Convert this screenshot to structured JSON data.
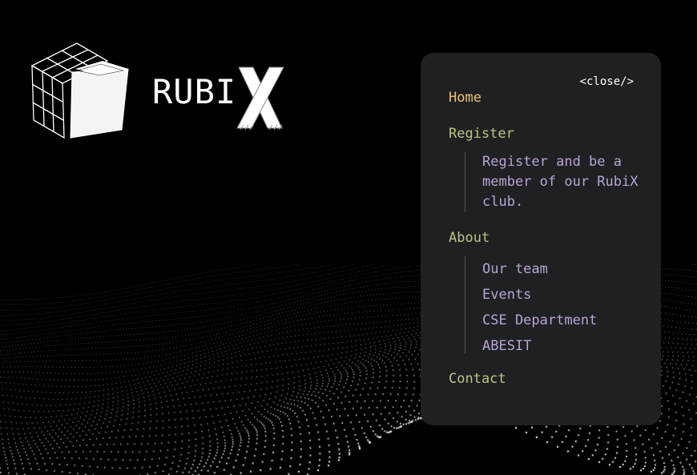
{
  "brand": {
    "name_main": "RUBI",
    "name_accent": "X"
  },
  "menu": {
    "close_label": "<close/>",
    "home": "Home",
    "register": "Register",
    "register_desc": "Register and be a member of our RubiX club.",
    "about": "About",
    "about_links": [
      "Our team",
      "Events",
      "CSE Department",
      "ABESIT"
    ],
    "contact": "Contact"
  },
  "colors": {
    "background": "#000000",
    "panel": "#1f2022",
    "active_item": "#f0c26a",
    "menu_item": "#b9c77c",
    "sub_item": "#b8a4d6"
  },
  "icons": {
    "logo": "rubiks-cube-icon",
    "background": "dotted-wave-pattern"
  }
}
